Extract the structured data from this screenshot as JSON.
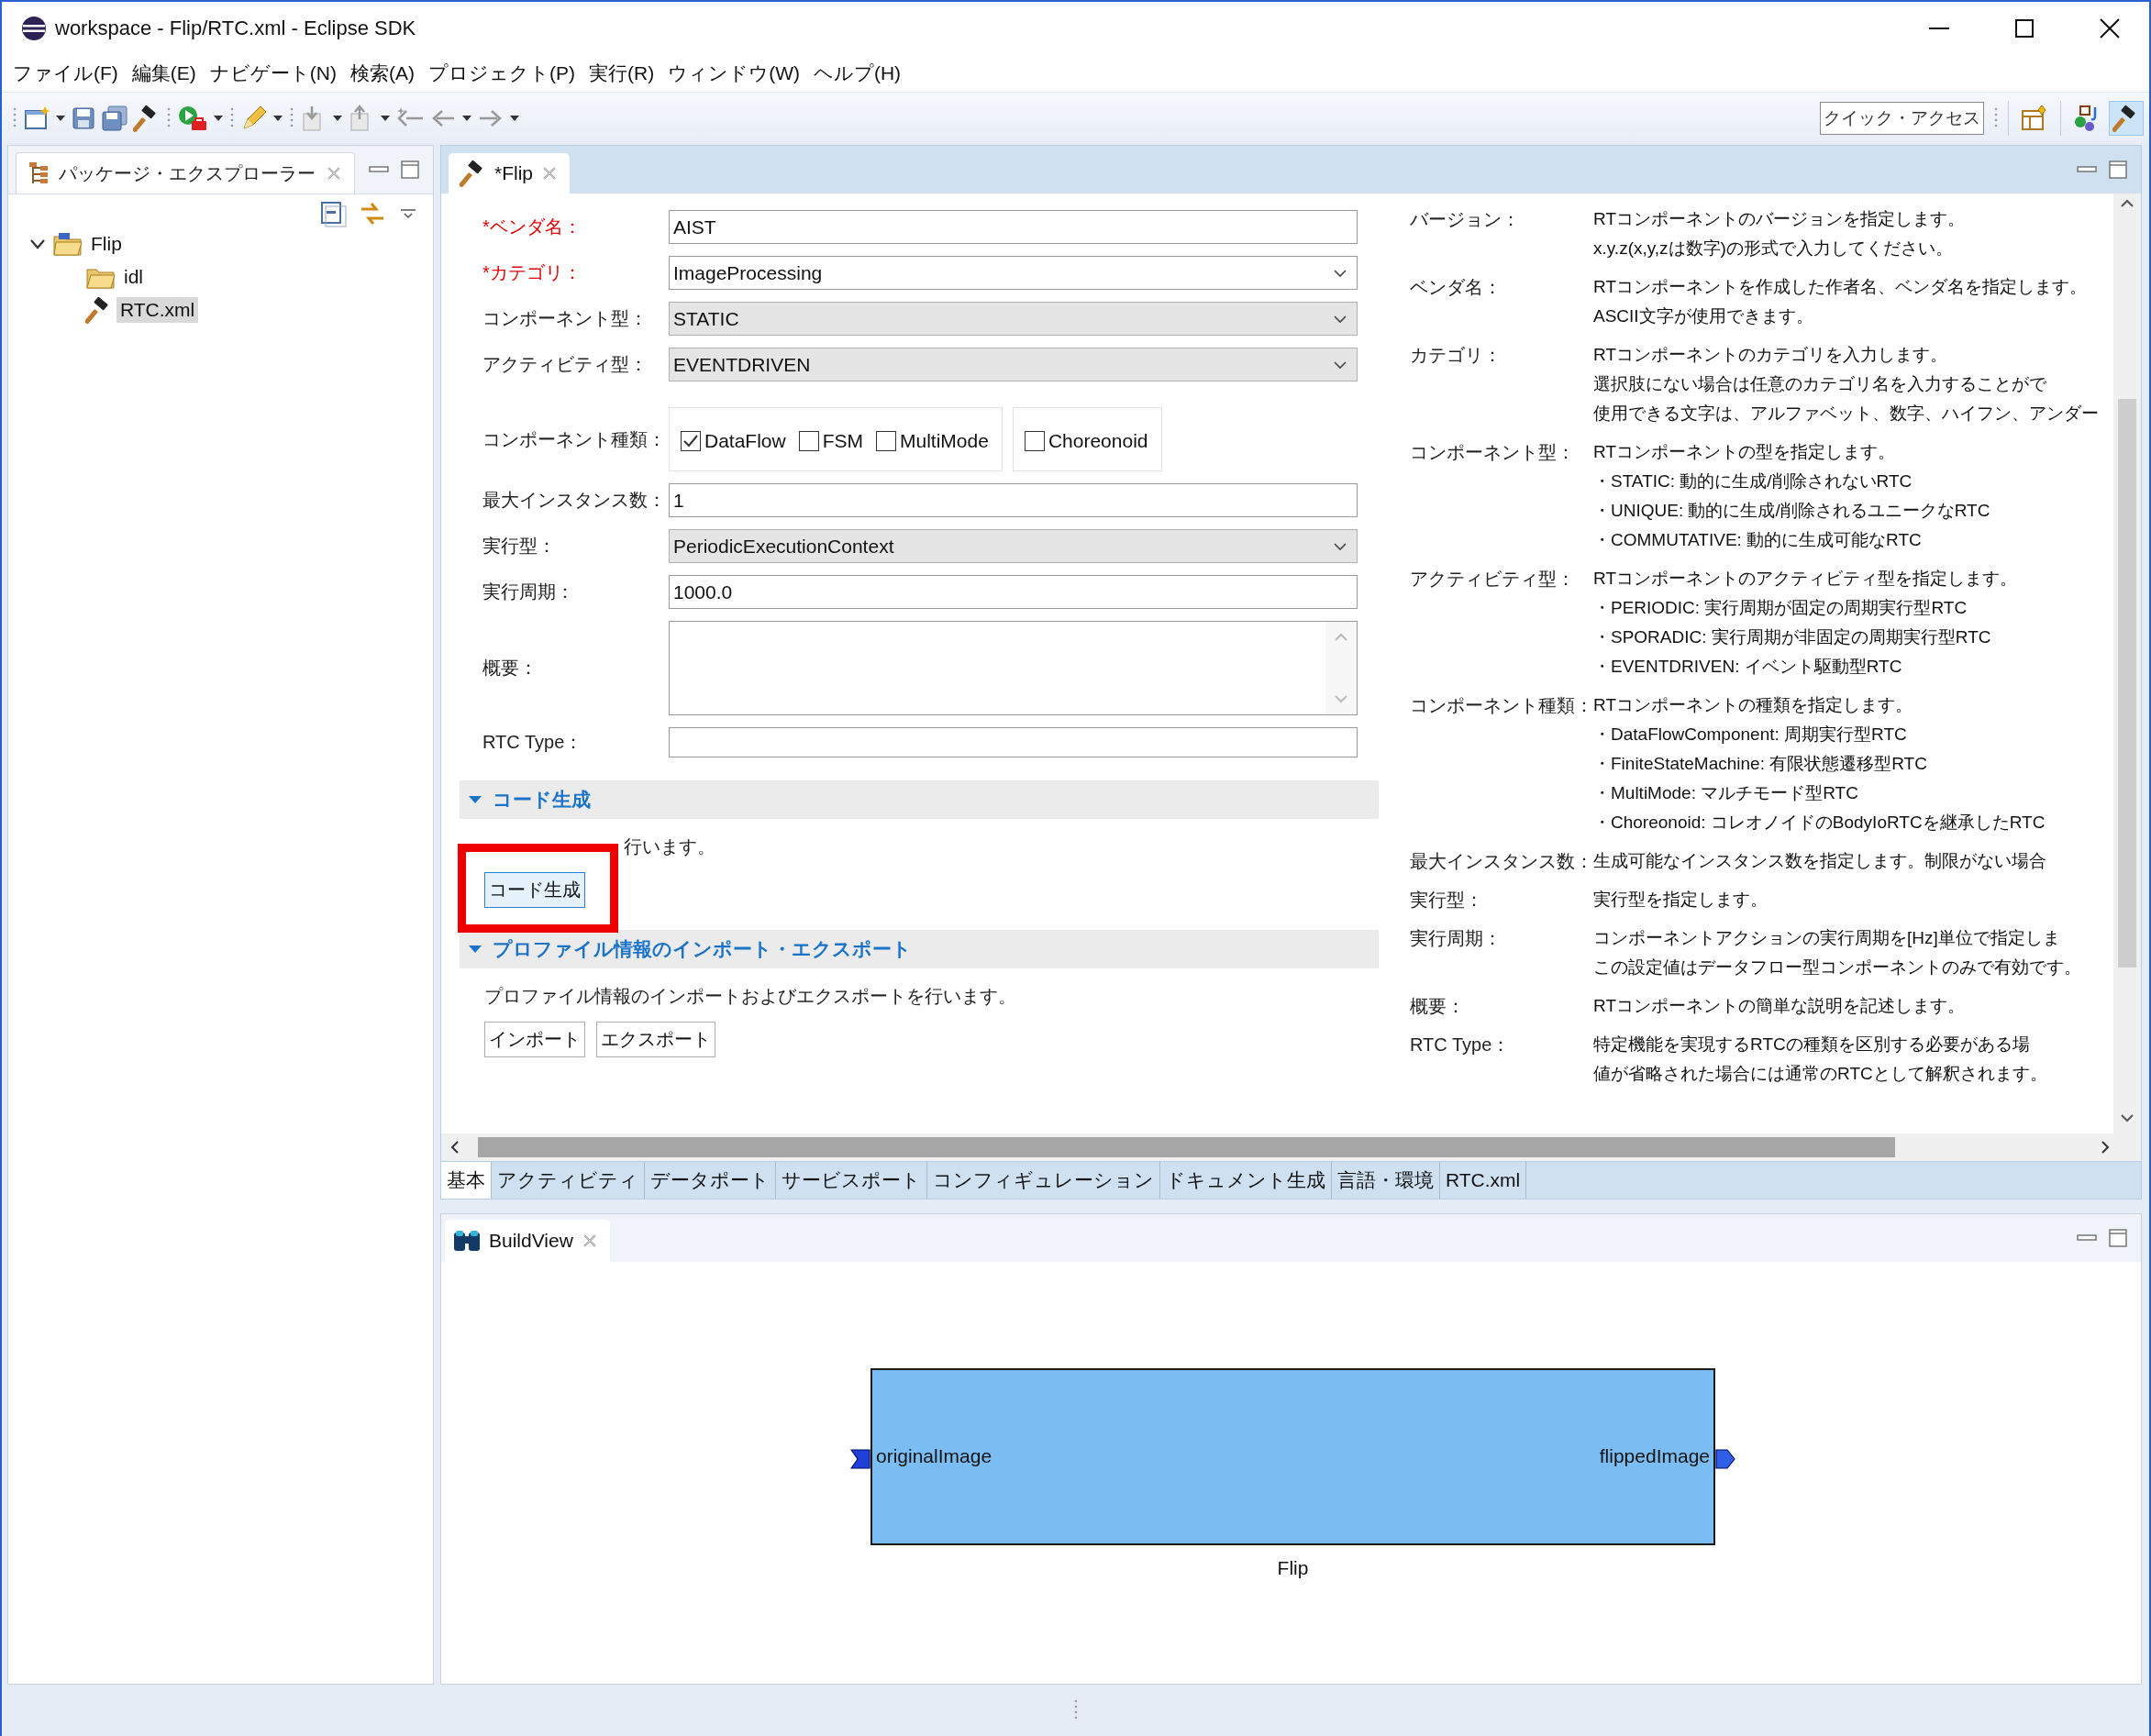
{
  "window": {
    "title": "workspace - Flip/RTC.xml - Eclipse SDK"
  },
  "menu": [
    "ファイル(F)",
    "編集(E)",
    "ナビゲート(N)",
    "検索(A)",
    "プロジェクト(P)",
    "実行(R)",
    "ウィンドウ(W)",
    "ヘルプ(H)"
  ],
  "quick_access": {
    "placeholder": "クイック・アクセス"
  },
  "perspectives": [
    {
      "kind": "open",
      "selected": false
    },
    {
      "kind": "java",
      "selected": false
    },
    {
      "kind": "rt",
      "selected": true
    }
  ],
  "explorer": {
    "title": "パッケージ・エクスプローラー",
    "tree": [
      {
        "label": "Flip",
        "kind": "project",
        "expanded": true,
        "selected": false,
        "children": [
          {
            "label": "idl",
            "kind": "folder",
            "selected": false
          },
          {
            "label": "RTC.xml",
            "kind": "file",
            "selected": true
          }
        ]
      }
    ]
  },
  "editor": {
    "tab": "*Flip",
    "form": [
      {
        "kind": "text",
        "label": "*ベンダ名：",
        "required": true,
        "value": "AIST"
      },
      {
        "kind": "combo",
        "label": "*カテゴリ：",
        "required": true,
        "value": "ImageProcessing"
      },
      {
        "kind": "select",
        "label": "コンポーネント型：",
        "required": false,
        "value": "STATIC"
      },
      {
        "kind": "select",
        "label": "アクティビティ型：",
        "required": false,
        "value": "EVENTDRIVEN"
      },
      {
        "kind": "checks",
        "label": "コンポーネント種類：",
        "required": false,
        "groups": [
          [
            {
              "label": "DataFlow",
              "checked": true
            },
            {
              "label": "FSM",
              "checked": false
            },
            {
              "label": "MultiMode",
              "checked": false
            }
          ],
          [
            {
              "label": "Choreonoid",
              "checked": false
            }
          ]
        ]
      },
      {
        "kind": "text",
        "label": "最大インスタンス数：",
        "required": false,
        "value": "1"
      },
      {
        "kind": "select",
        "label": "実行型：",
        "required": false,
        "value": "PeriodicExecutionContext"
      },
      {
        "kind": "text",
        "label": "実行周期：",
        "required": false,
        "value": "1000.0"
      },
      {
        "kind": "textarea",
        "label": "概要：",
        "required": false
      },
      {
        "kind": "text",
        "label": "RTC Type：",
        "required": false
      }
    ],
    "sections": [
      {
        "title": "コード生成",
        "expanded": true,
        "highlighted": true,
        "description": "行います。",
        "buttons": [
          "コード生成"
        ]
      },
      {
        "title": "プロファイル情報のインポート・エクスポート",
        "expanded": true,
        "highlighted": false,
        "description": "プロファイル情報のインポートおよびエクスポートを行います。",
        "buttons": [
          "インポート",
          "エクスポート"
        ]
      }
    ],
    "help": [
      {
        "term": "バージョン：",
        "lines": [
          "RTコンポーネントのバージョンを指定します。",
          "x.y.z(x,y,zは数字)の形式で入力してください。"
        ]
      },
      {
        "term": "ベンダ名：",
        "lines": [
          "RTコンポーネントを作成した作者名、ベンダ名を指定します。",
          "ASCII文字が使用できます。"
        ]
      },
      {
        "term": "カテゴリ：",
        "lines": [
          "RTコンポーネントのカテゴリを入力します。",
          "選択肢にない場合は任意のカテゴリ名を入力することがで",
          "使用できる文字は、アルファベット、数字、ハイフン、アンダー"
        ]
      },
      {
        "term": "コンポーネント型：",
        "lines": [
          "RTコンポーネントの型を指定します。",
          "・STATIC: 動的に生成/削除されないRTC",
          "・UNIQUE: 動的に生成/削除されるユニークなRTC",
          "・COMMUTATIVE: 動的に生成可能なRTC"
        ]
      },
      {
        "term": "アクティビティ型：",
        "lines": [
          "RTコンポーネントのアクティビティ型を指定します。",
          "・PERIODIC: 実行周期が固定の周期実行型RTC",
          "・SPORADIC: 実行周期が非固定の周期実行型RTC",
          "・EVENTDRIVEN: イベント駆動型RTC"
        ]
      },
      {
        "term": "コンポーネント種類：",
        "lines": [
          "RTコンポーネントの種類を指定します。",
          "・DataFlowComponent: 周期実行型RTC",
          "・FiniteStateMachine: 有限状態遷移型RTC",
          "・MultiMode: マルチモード型RTC",
          "・Choreonoid: コレオノイドのBodyIoRTCを継承したRTC"
        ]
      },
      {
        "term": "最大インスタンス数：",
        "lines": [
          "生成可能なインスタンス数を指定します。制限がない場合"
        ]
      },
      {
        "term": "実行型：",
        "lines": [
          "実行型を指定します。"
        ]
      },
      {
        "term": "実行周期：",
        "lines": [
          "コンポーネントアクションの実行周期を[Hz]単位で指定しま",
          "この設定値はデータフロー型コンポーネントのみで有効です。"
        ]
      },
      {
        "term": "概要：",
        "lines": [
          "RTコンポーネントの簡単な説明を記述します。"
        ]
      },
      {
        "term": "RTC Type：",
        "lines": [
          "特定機能を実現するRTCの種類を区別する必要がある場",
          "値が省略された場合には通常のRTCとして解釈されます。"
        ]
      }
    ],
    "pages": [
      {
        "label": "基本",
        "selected": true
      },
      {
        "label": "アクティビティ",
        "selected": false
      },
      {
        "label": "データポート",
        "selected": false
      },
      {
        "label": "サービスポート",
        "selected": false
      },
      {
        "label": "コンフィギュレーション",
        "selected": false
      },
      {
        "label": "ドキュメント生成",
        "selected": false
      },
      {
        "label": "言語・環境",
        "selected": false
      },
      {
        "label": "RTC.xml",
        "selected": false
      }
    ]
  },
  "build_view": {
    "title": "BuildView",
    "component": {
      "name": "Flip",
      "inports": [
        "originalImage"
      ],
      "outports": [
        "flippedImage"
      ]
    }
  }
}
